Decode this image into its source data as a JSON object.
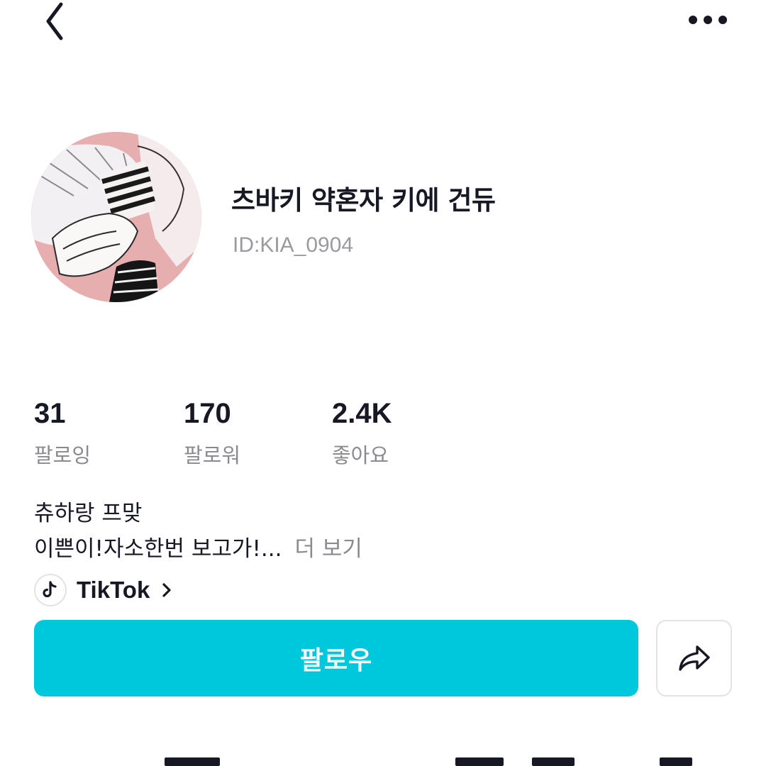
{
  "header": {
    "back_icon": "chevron-left-icon",
    "more_icon": "more-horizontal-icon"
  },
  "profile": {
    "nickname": "츠바키 약혼자 키에 건듀",
    "user_id": "ID:KIA_0904",
    "avatar_colors": {
      "background": "#e9b3b3",
      "hair": "#f2f0f2",
      "ink": "#1a1a1a"
    }
  },
  "stats": {
    "following": {
      "value": "31",
      "label": "팔로잉"
    },
    "followers": {
      "value": "170",
      "label": "팔로워"
    },
    "likes": {
      "value": "2.4K",
      "label": "좋아요"
    }
  },
  "bio": {
    "line1": "츄하랑 프맞",
    "line2": "이쁜이!자소한번 보고가!...",
    "more_label": "더 보기"
  },
  "link": {
    "icon": "tiktok-icon",
    "label": "TikTok",
    "chevron_icon": "chevron-right-icon"
  },
  "actions": {
    "follow_label": "팔로우",
    "share_icon": "share-arrow-icon"
  },
  "colors": {
    "accent": "#00c8dc",
    "text_primary": "#161823",
    "text_secondary": "#8a8b91",
    "id_text": "#9a9aa0",
    "border": "#e3e3e4"
  }
}
